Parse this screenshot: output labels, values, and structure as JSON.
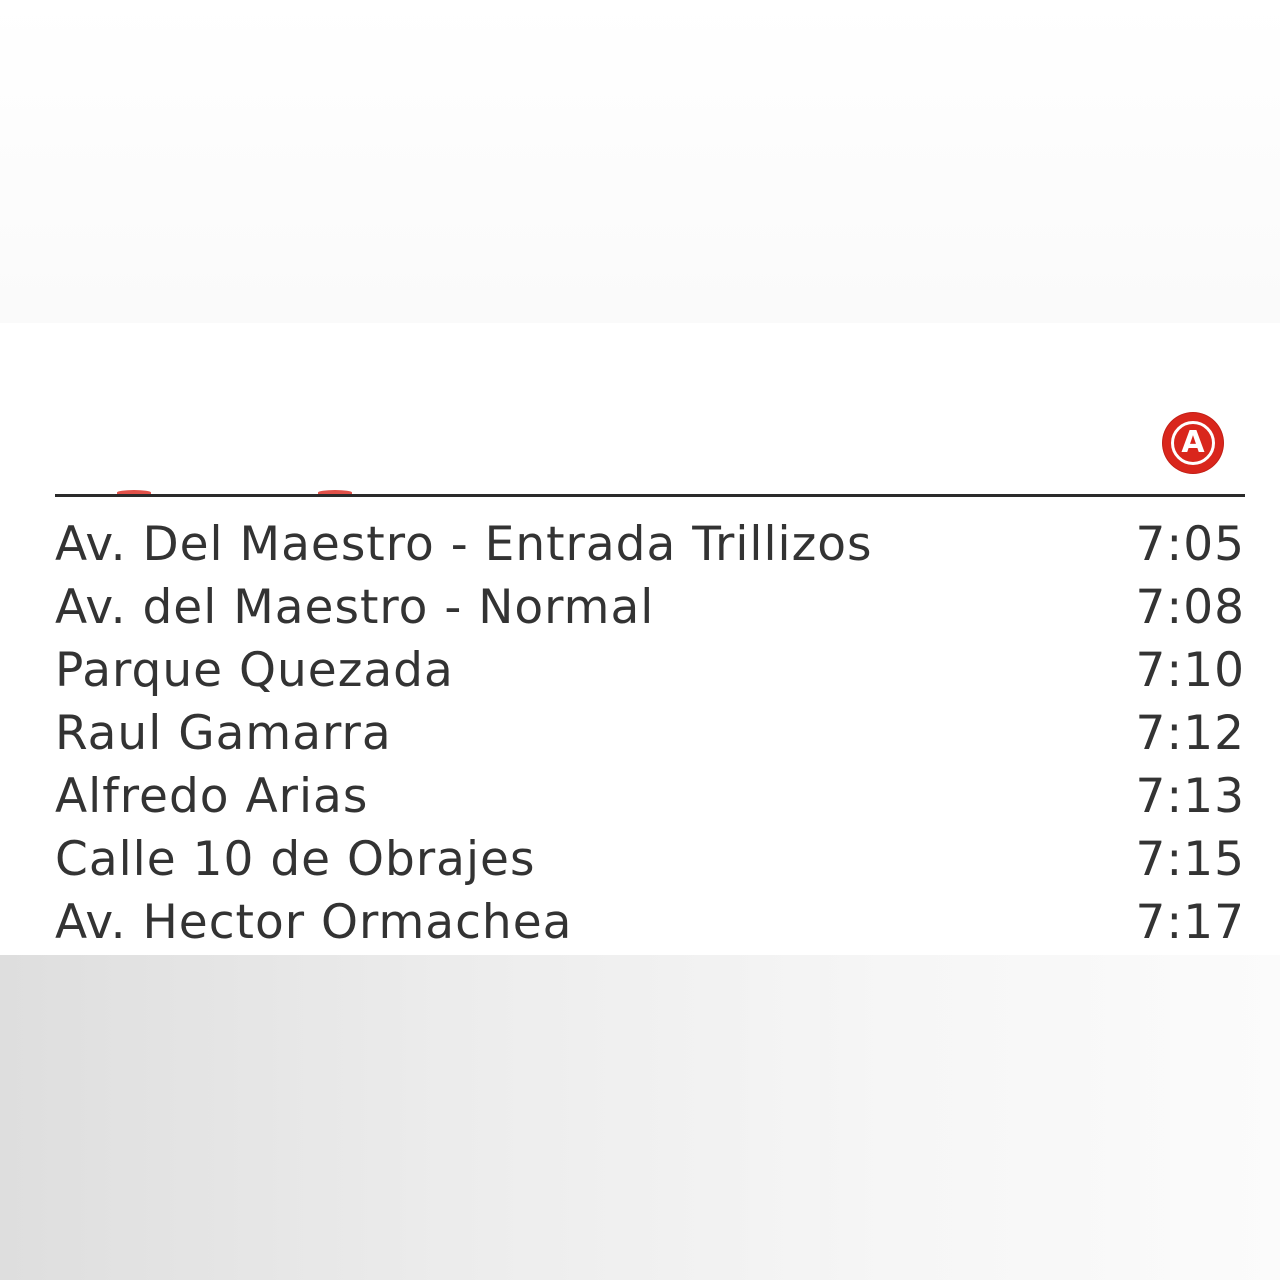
{
  "route": {
    "letter": "A",
    "color": "#d9261c"
  },
  "stops": [
    {
      "name": "Av. Del Maestro - Entrada Trillizos",
      "time": "7:05"
    },
    {
      "name": "Av. del Maestro - Normal",
      "time": "7:08"
    },
    {
      "name": "Parque Quezada",
      "time": "7:10"
    },
    {
      "name": "Raul Gamarra",
      "time": "7:12"
    },
    {
      "name": "Alfredo Arias",
      "time": "7:13"
    },
    {
      "name": "Calle 10 de Obrajes",
      "time": "7:15"
    },
    {
      "name": "Av. Hector Ormachea",
      "time": "7:17"
    }
  ]
}
